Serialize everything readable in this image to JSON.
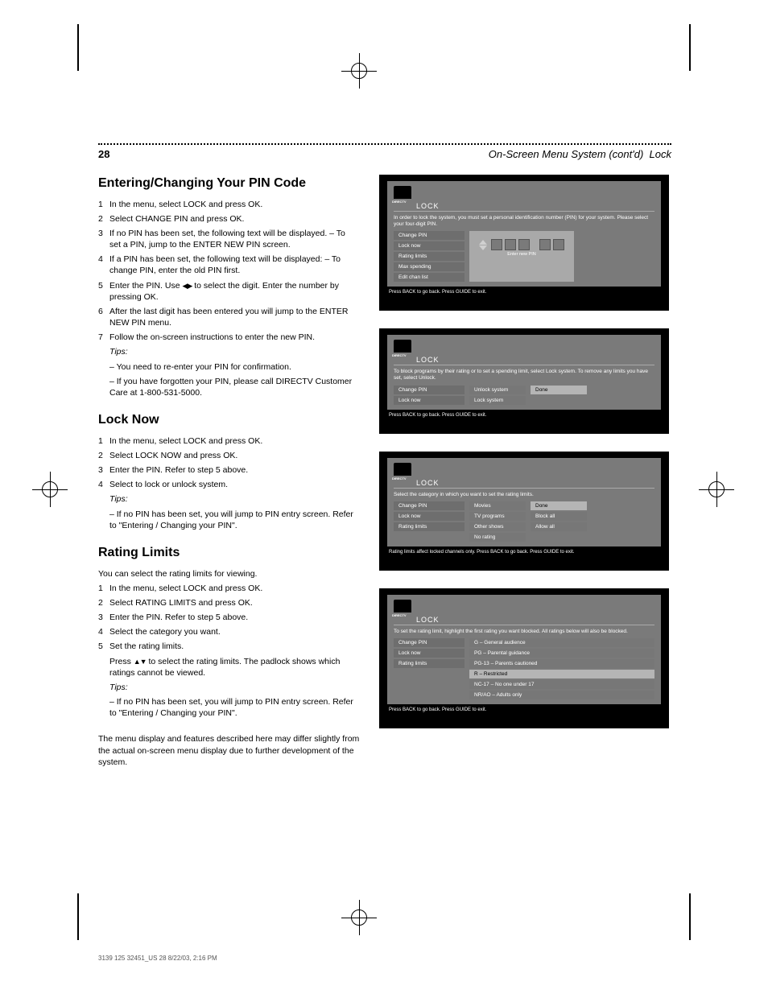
{
  "header": {
    "page_number": "28",
    "breadcrumb": "On-Screen Menu System (cont'd)",
    "sub": "Lock"
  },
  "footer_imprint": "3139 125 32451_US    28    8/22/03, 2:16 PM",
  "sections": {
    "s1": {
      "title": "Entering/Changing Your PIN Code",
      "steps": [
        "In the menu, select LOCK and press OK.",
        "Select CHANGE PIN and press OK.",
        "If no PIN has been set, the following text will be displayed. – To set a PIN, jump to the ENTER NEW PIN screen.",
        "If a PIN has been set, the following text will be displayed: – To change PIN, enter the old PIN first.",
        "Enter the PIN. Use ◀▶ to select the digit. Enter the number by pressing OK.",
        "After the last digit has been entered you will jump to the ENTER NEW PIN menu.",
        "Follow the on-screen instructions to enter the new PIN."
      ],
      "notes_label": "Tips:",
      "notes": [
        "– You need to re-enter your PIN for confirmation.",
        "– If you have forgotten your PIN, please call DIRECTV Customer Care at 1-800-531-5000."
      ]
    },
    "s2": {
      "title": "Lock Now",
      "steps": [
        "In the menu, select LOCK and press OK.",
        "Select LOCK NOW and press OK.",
        "Enter the PIN. Refer to step 5 above.",
        "Select to lock or unlock system."
      ],
      "notes_label": "Tips:",
      "notes": [
        "– If no PIN has been set, you will jump to PIN entry screen. Refer to \"Entering / Changing your PIN\"."
      ]
    },
    "s3": {
      "title": "Rating Limits",
      "intro": "You can select the rating limits for viewing.",
      "steps": [
        "In the menu, select LOCK and press OK.",
        "Select RATING LIMITS and press OK.",
        "Enter the PIN. Refer to step 5 above.",
        "Select the category you want.",
        "Set the rating limits."
      ],
      "sub": "Press ▲▼ to select the rating limits. The padlock shows which ratings cannot be viewed.",
      "notes_label": "Tips:",
      "notes": [
        "– If no PIN has been set, you will jump to PIN entry screen. Refer to \"Entering / Changing your PIN\"."
      ]
    }
  },
  "tiles": {
    "t1": {
      "title": "LOCK",
      "desc": "In order to lock the system, you must set a personal identification number (PIN) for your system. Please select your four-digit PIN.",
      "menu": [
        "Change PIN",
        "Lock now",
        "Rating limits",
        "Max spending",
        "Edit chan list"
      ],
      "pin_label": "Enter new PIN",
      "hint": "Press BACK to go back. Press GUIDE to exit."
    },
    "t2": {
      "title": "LOCK",
      "desc": "To block programs by their rating or to set a spending limit, select Lock system. To remove any limits you have set, select Unlock.",
      "menu": [
        "Change PIN",
        "Lock now"
      ],
      "col2": [
        "Unlock system",
        "Lock system"
      ],
      "col3": [
        "Done"
      ],
      "hint": "Press BACK to go back. Press GUIDE to exit."
    },
    "t3": {
      "title": "LOCK",
      "desc": "Select the category in which you want to set the rating limits.",
      "menu": [
        "Change PIN",
        "Lock now",
        "Rating limits"
      ],
      "col2": [
        "Movies",
        "TV programs",
        "Other shows",
        "No rating"
      ],
      "col3": [
        "Done",
        "Block all",
        "Allow all"
      ],
      "hint": "Rating limits affect locked channels only. Press BACK to go back. Press GUIDE to exit."
    },
    "t4": {
      "title": "LOCK",
      "desc": "To set the rating limit, highlight the first rating you want blocked. All ratings below will also be blocked.",
      "menu": [
        "Change PIN",
        "Lock now",
        "Rating limits"
      ],
      "panel": [
        "G – General audience",
        "PG – Parental guidance",
        "PG-13 – Parents cautioned",
        "R – Restricted",
        "NC-17 – No one under 17",
        "NR/AO – Adults only"
      ],
      "hint": "Press BACK to go back. Press GUIDE to exit."
    }
  },
  "footnote": "The menu display and features described here may differ slightly from the actual on-screen menu display due to further development of the system."
}
